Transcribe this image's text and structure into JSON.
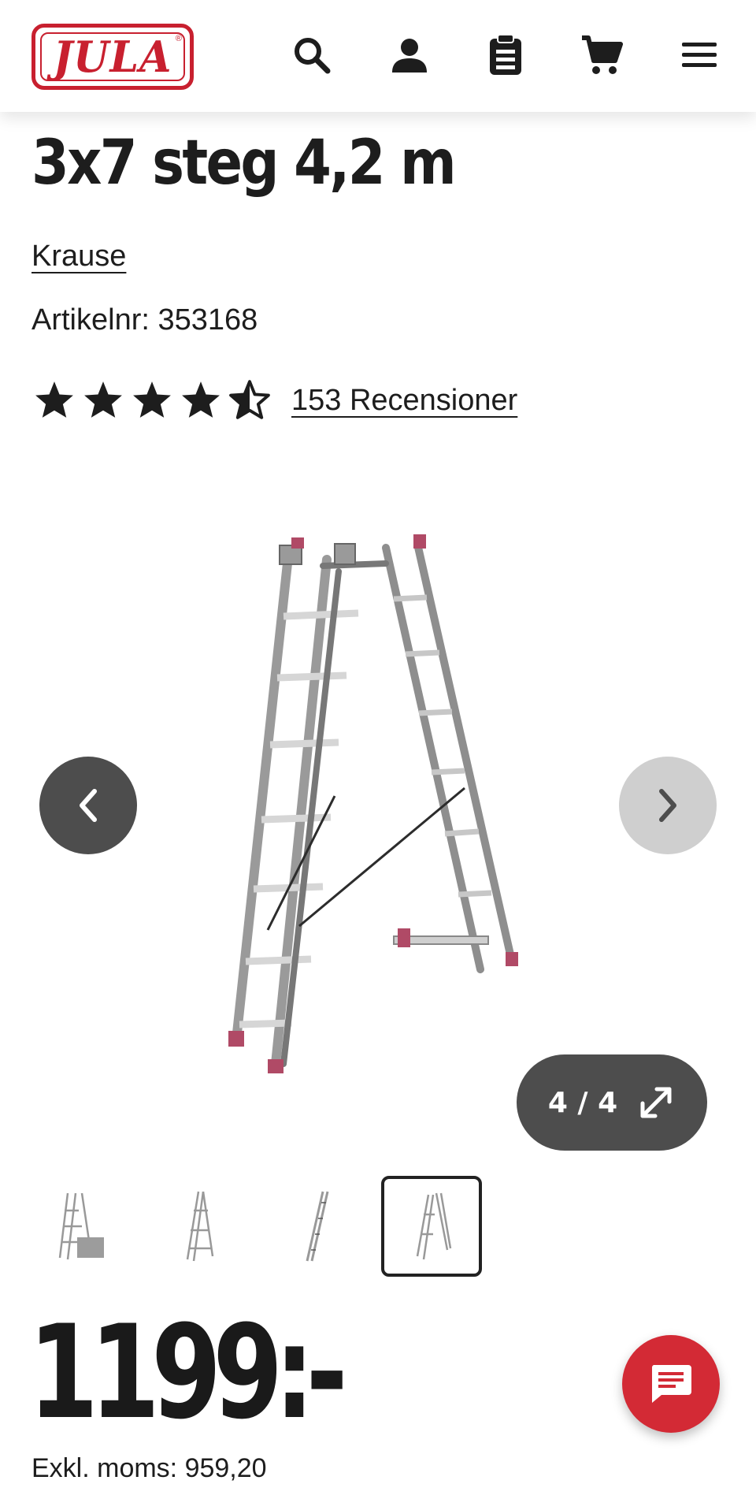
{
  "header": {
    "logo_text": "JULA",
    "logo_mark": "®",
    "icons": [
      "search-icon",
      "user-icon",
      "clipboard-icon",
      "cart-icon",
      "menu-icon"
    ]
  },
  "product": {
    "title": "3x7 steg 4,2 m",
    "brand": "Krause",
    "article_number": "Artikelnr: 353168",
    "rating": {
      "value": 4.5,
      "max": 5
    },
    "reviews_label": "153 Recensioner"
  },
  "gallery": {
    "counter": "4 / 4",
    "current": 4,
    "total": 4,
    "prev_icon": "chevron-left-icon",
    "next_icon": "chevron-right-icon",
    "expand_icon": "expand-icon"
  },
  "price": {
    "amount": "1199:-",
    "excl_vat": "Exkl. moms: 959,20"
  },
  "colors": {
    "brand_red": "#c8202f",
    "chat_red": "#d32a35",
    "dark_button": "#4d4d4d",
    "light_button": "#cfcfcf",
    "text": "#1d1d1d"
  }
}
